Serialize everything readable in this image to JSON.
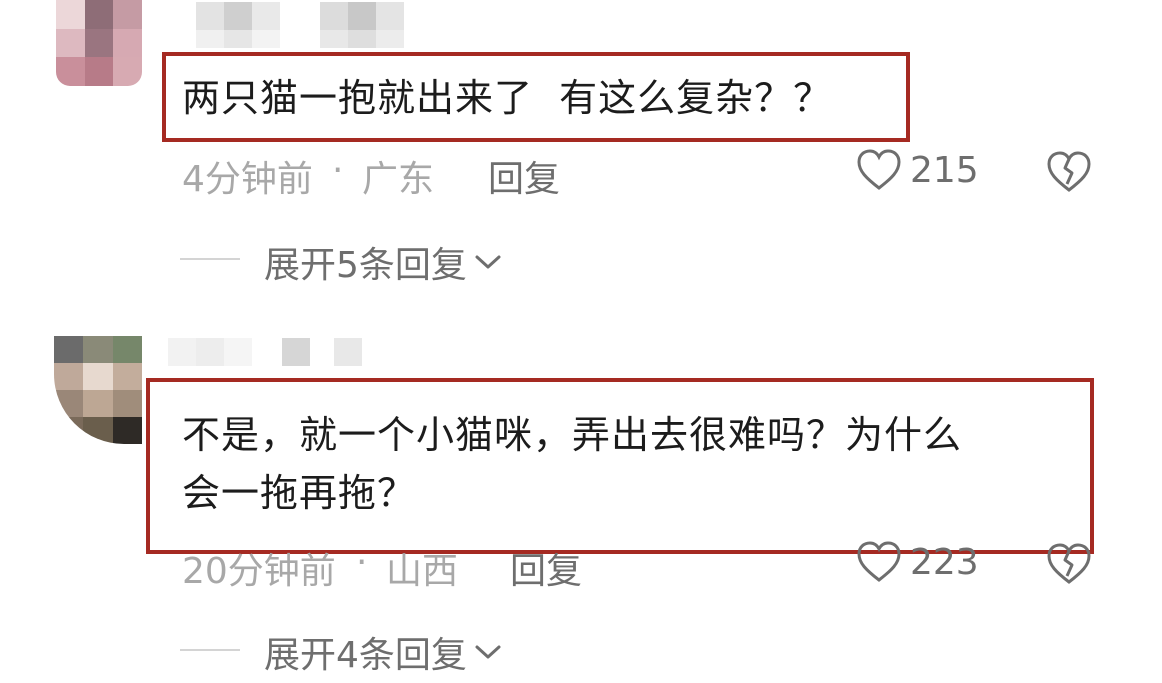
{
  "comments": [
    {
      "text": "两只猫一抱就出来了  有这么复杂？？",
      "time": "4分钟前",
      "separator": "·",
      "location": "广东",
      "reply_label": "回复",
      "likes": "215",
      "expand_label": "展开5条回复"
    },
    {
      "text": "不是，就一个小猫咪，弄出去很难吗？为什么\n会一拖再拖？",
      "time": "20分钟前",
      "separator": "·",
      "location": "山西",
      "reply_label": "回复",
      "likes": "223",
      "expand_label": "展开4条回复"
    }
  ],
  "colors": {
    "highlight_border": "#a52a22",
    "meta_text": "#a8a8a8",
    "action_text": "#6e6e6e"
  }
}
